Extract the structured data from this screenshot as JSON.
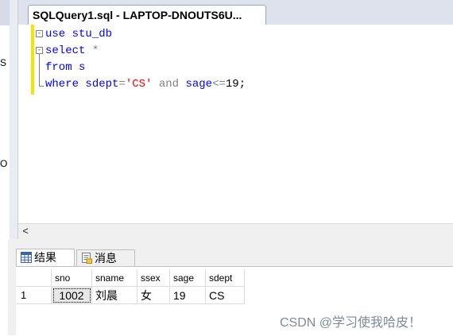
{
  "left_panel": {
    "fragments": [
      "S",
      "O"
    ]
  },
  "document_tab": {
    "title": "SQLQuery1.sql - LAPTOP-DNOUTS6U..."
  },
  "editor": {
    "lines": [
      {
        "tokens": [
          {
            "t": "use",
            "c": "kw"
          },
          {
            "t": " stu_db",
            "c": "kw"
          }
        ]
      },
      {
        "tokens": [
          {
            "t": "select",
            "c": "kw"
          },
          {
            "t": " *",
            "c": "gray"
          }
        ]
      },
      {
        "tokens": [
          {
            "t": "from",
            "c": "kw"
          },
          {
            "t": " s",
            "c": "kw"
          }
        ]
      },
      {
        "tokens": [
          {
            "t": "where",
            "c": "kw"
          },
          {
            "t": " sdept",
            "c": "kw"
          },
          {
            "t": "=",
            "c": "gray"
          },
          {
            "t": "'CS'",
            "c": "str"
          },
          {
            "t": " and",
            "c": "gray"
          },
          {
            "t": " sage",
            "c": "kw"
          },
          {
            "t": "<=",
            "c": "gray"
          },
          {
            "t": "19;",
            "c": ""
          }
        ]
      }
    ],
    "fold_marker": "-"
  },
  "hscroll": {
    "left_arrow": "<"
  },
  "results": {
    "tabs": {
      "results_label": "结果",
      "messages_label": "消息"
    },
    "columns": [
      "sno",
      "sname",
      "ssex",
      "sage",
      "sdept"
    ],
    "rows": [
      {
        "rownum": "1",
        "cells": [
          "1002",
          "刘晨",
          "女",
          "19",
          "CS"
        ]
      }
    ]
  },
  "watermark": "CSDN @学习使我哈皮！",
  "colors": {
    "keyword": "#0000ff",
    "string": "#ff0000",
    "operator": "#808080",
    "gutter_marker": "#f2e600"
  }
}
